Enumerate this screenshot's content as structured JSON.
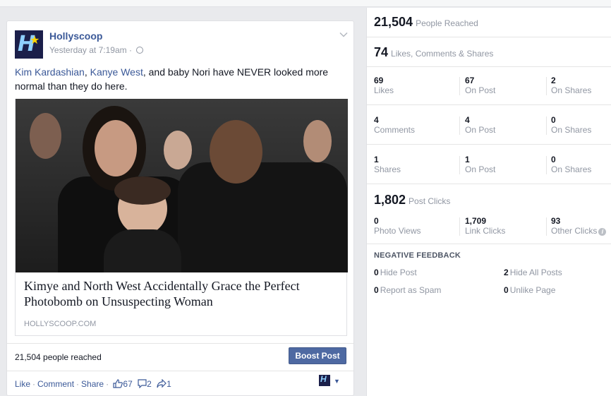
{
  "post": {
    "page_name": "Hollyscoop",
    "timestamp": "Yesterday at 7:19am",
    "text_parts": [
      {
        "text": "Kim Kardashian",
        "link": true
      },
      {
        "text": ", ",
        "link": false
      },
      {
        "text": "Kanye West",
        "link": true
      },
      {
        "text": ", and baby Nori have NEVER looked more normal than they do here.",
        "link": false
      }
    ],
    "link_title": "Kimye and North West Accidentally Grace the Perfect Photobomb on Unsuspecting Woman",
    "link_domain": "HOLLYSCOOP.COM",
    "reach_text": "21,504 people reached",
    "boost_label": "Boost Post",
    "actions": {
      "like": "Like",
      "comment": "Comment",
      "share": "Share",
      "like_count": "67",
      "comment_count": "2",
      "share_count": "1"
    }
  },
  "insights": {
    "reached": {
      "value": "21,504",
      "label": "People Reached"
    },
    "engagement": {
      "value": "74",
      "label": "Likes, Comments & Shares"
    },
    "grid": [
      [
        {
          "n": "69",
          "l": "Likes"
        },
        {
          "n": "67",
          "l": "On Post"
        },
        {
          "n": "2",
          "l": "On Shares"
        }
      ],
      [
        {
          "n": "4",
          "l": "Comments"
        },
        {
          "n": "4",
          "l": "On Post"
        },
        {
          "n": "0",
          "l": "On Shares"
        }
      ],
      [
        {
          "n": "1",
          "l": "Shares"
        },
        {
          "n": "1",
          "l": "On Post"
        },
        {
          "n": "0",
          "l": "On Shares"
        }
      ]
    ],
    "clicks": {
      "value": "1,802",
      "label": "Post Clicks"
    },
    "clicks_grid": [
      {
        "n": "0",
        "l": "Photo Views"
      },
      {
        "n": "1,709",
        "l": "Link Clicks"
      },
      {
        "n": "93",
        "l": "Other Clicks"
      }
    ],
    "negative_heading": "NEGATIVE FEEDBACK",
    "negative": [
      {
        "n": "0",
        "l": "Hide Post"
      },
      {
        "n": "2",
        "l": "Hide All Posts"
      },
      {
        "n": "0",
        "l": "Report as Spam"
      },
      {
        "n": "0",
        "l": "Unlike Page"
      }
    ]
  },
  "colors": {
    "link": "#3b5998",
    "boost_button": "#4e69a2",
    "muted": "#9197a3"
  },
  "icons": [
    "globe-icon",
    "chevron-down-icon",
    "like-icon",
    "comment-icon",
    "share-icon",
    "info-icon"
  ]
}
